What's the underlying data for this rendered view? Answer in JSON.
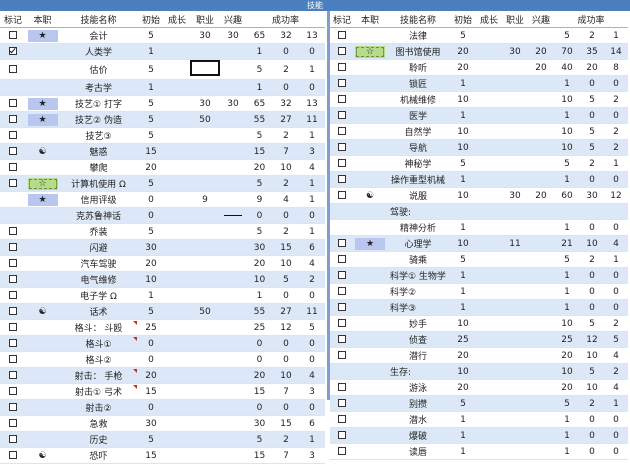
{
  "banner": {
    "title": "技能"
  },
  "headers": [
    "标记",
    "本职",
    "技能名称",
    "初始",
    "成长",
    "职业",
    "兴趣",
    "成功率"
  ],
  "left_rows": [
    {
      "mark": "empty",
      "occ": "star",
      "occ_style": "blue",
      "name": "会计",
      "base": "5",
      "grow": "",
      "job": "30",
      "hobby": "30",
      "s1": "65",
      "s2": "32",
      "s3": "13"
    },
    {
      "mark": "checked",
      "occ": "",
      "occ_style": "",
      "name": "人类学",
      "base": "1",
      "grow": "",
      "job": "",
      "hobby": "",
      "s1": "1",
      "s2": "0",
      "s3": "0"
    },
    {
      "mark": "empty",
      "occ": "",
      "occ_style": "",
      "name": "估价",
      "base": "5",
      "grow": "",
      "job": "",
      "hobby": "",
      "s1": "5",
      "s2": "2",
      "s3": "1",
      "job_boxed": true
    },
    {
      "mark": "none",
      "occ": "",
      "occ_style": "",
      "name": "考古学",
      "base": "1",
      "grow": "",
      "job": "",
      "hobby": "",
      "s1": "1",
      "s2": "0",
      "s3": "0"
    },
    {
      "mark": "empty",
      "occ": "star",
      "occ_style": "blue",
      "name": "技艺① 打字",
      "base": "5",
      "grow": "",
      "job": "30",
      "hobby": "30",
      "s1": "65",
      "s2": "32",
      "s3": "13"
    },
    {
      "mark": "empty",
      "occ": "star",
      "occ_style": "blue",
      "name": "技艺② 伪造",
      "base": "5",
      "grow": "",
      "job": "50",
      "hobby": "",
      "s1": "55",
      "s2": "27",
      "s3": "11"
    },
    {
      "mark": "empty",
      "occ": "",
      "occ_style": "",
      "name": "技艺③",
      "base": "5",
      "grow": "",
      "job": "",
      "hobby": "",
      "s1": "5",
      "s2": "2",
      "s3": "1"
    },
    {
      "mark": "empty",
      "occ": "yinyang",
      "occ_style": "",
      "name": "魅惑",
      "base": "15",
      "grow": "",
      "job": "",
      "hobby": "",
      "s1": "15",
      "s2": "7",
      "s3": "3"
    },
    {
      "mark": "empty",
      "occ": "",
      "occ_style": "",
      "name": "攀爬",
      "base": "20",
      "grow": "",
      "job": "",
      "hobby": "",
      "s1": "20",
      "s2": "10",
      "s3": "4"
    },
    {
      "mark": "empty",
      "occ": "hollow-star",
      "occ_style": "green",
      "name": "计算机使用 Ω",
      "base": "5",
      "grow": "",
      "job": "",
      "hobby": "",
      "s1": "5",
      "s2": "2",
      "s3": "1"
    },
    {
      "mark": "none",
      "occ": "star",
      "occ_style": "blue",
      "name": "信用评级",
      "base": "0",
      "grow": "",
      "job": "9",
      "hobby": "",
      "s1": "9",
      "s2": "4",
      "s3": "1"
    },
    {
      "mark": "none",
      "occ": "",
      "occ_style": "",
      "name": "克苏鲁神话",
      "base": "0",
      "grow": "",
      "job": "",
      "hobby": "",
      "s1": "0",
      "s2": "0",
      "s3": "0",
      "hobby_dash": true
    },
    {
      "mark": "empty",
      "occ": "",
      "occ_style": "",
      "name": "乔装",
      "base": "5",
      "grow": "",
      "job": "",
      "hobby": "",
      "s1": "5",
      "s2": "2",
      "s3": "1"
    },
    {
      "mark": "empty",
      "occ": "",
      "occ_style": "",
      "name": "闪避",
      "base": "30",
      "grow": "",
      "job": "",
      "hobby": "",
      "s1": "30",
      "s2": "15",
      "s3": "6"
    },
    {
      "mark": "empty",
      "occ": "",
      "occ_style": "",
      "name": "汽车驾驶",
      "base": "20",
      "grow": "",
      "job": "",
      "hobby": "",
      "s1": "20",
      "s2": "10",
      "s3": "4"
    },
    {
      "mark": "empty",
      "occ": "",
      "occ_style": "",
      "name": "电气维修",
      "base": "10",
      "grow": "",
      "job": "",
      "hobby": "",
      "s1": "10",
      "s2": "5",
      "s3": "2"
    },
    {
      "mark": "empty",
      "occ": "",
      "occ_style": "",
      "name": "电子学 Ω",
      "base": "1",
      "grow": "",
      "job": "",
      "hobby": "",
      "s1": "1",
      "s2": "0",
      "s3": "0"
    },
    {
      "mark": "empty",
      "occ": "yinyang",
      "occ_style": "",
      "name": "话术",
      "base": "5",
      "grow": "",
      "job": "50",
      "hobby": "",
      "s1": "55",
      "s2": "27",
      "s3": "11"
    },
    {
      "mark": "empty",
      "occ": "",
      "occ_style": "",
      "name": "格斗：  斗殴",
      "base": "25",
      "grow": "",
      "job": "",
      "hobby": "",
      "s1": "25",
      "s2": "12",
      "s3": "5",
      "flag": true
    },
    {
      "mark": "empty",
      "occ": "",
      "occ_style": "",
      "name": "格斗①",
      "base": "0",
      "grow": "",
      "job": "",
      "hobby": "",
      "s1": "0",
      "s2": "0",
      "s3": "0",
      "flag": true
    },
    {
      "mark": "empty",
      "occ": "",
      "occ_style": "",
      "name": "格斗②",
      "base": "0",
      "grow": "",
      "job": "",
      "hobby": "",
      "s1": "0",
      "s2": "0",
      "s3": "0"
    },
    {
      "mark": "empty",
      "occ": "",
      "occ_style": "",
      "name": "射击：  手枪",
      "base": "20",
      "grow": "",
      "job": "",
      "hobby": "",
      "s1": "20",
      "s2": "10",
      "s3": "4",
      "flag": true
    },
    {
      "mark": "empty",
      "occ": "",
      "occ_style": "",
      "name": "射击① 弓术",
      "base": "15",
      "grow": "",
      "job": "",
      "hobby": "",
      "s1": "15",
      "s2": "7",
      "s3": "3",
      "flag": true
    },
    {
      "mark": "empty",
      "occ": "",
      "occ_style": "",
      "name": "射击②",
      "base": "0",
      "grow": "",
      "job": "",
      "hobby": "",
      "s1": "0",
      "s2": "0",
      "s3": "0"
    },
    {
      "mark": "empty",
      "occ": "",
      "occ_style": "",
      "name": "急救",
      "base": "30",
      "grow": "",
      "job": "",
      "hobby": "",
      "s1": "30",
      "s2": "15",
      "s3": "6"
    },
    {
      "mark": "empty",
      "occ": "",
      "occ_style": "",
      "name": "历史",
      "base": "5",
      "grow": "",
      "job": "",
      "hobby": "",
      "s1": "5",
      "s2": "2",
      "s3": "1"
    },
    {
      "mark": "empty",
      "occ": "yinyang",
      "occ_style": "",
      "name": "恐吓",
      "base": "15",
      "grow": "",
      "job": "",
      "hobby": "",
      "s1": "15",
      "s2": "7",
      "s3": "3"
    }
  ],
  "right_rows": [
    {
      "mark": "empty",
      "occ": "",
      "occ_style": "",
      "name": "法律",
      "base": "5",
      "grow": "",
      "job": "",
      "hobby": "",
      "s1": "5",
      "s2": "2",
      "s3": "1"
    },
    {
      "mark": "empty",
      "occ": "hollow-star",
      "occ_style": "green",
      "name": "图书馆使用",
      "base": "20",
      "grow": "",
      "job": "30",
      "hobby": "20",
      "s1": "70",
      "s2": "35",
      "s3": "14"
    },
    {
      "mark": "empty",
      "occ": "",
      "occ_style": "",
      "name": "聆听",
      "base": "20",
      "grow": "",
      "job": "",
      "hobby": "20",
      "s1": "40",
      "s2": "20",
      "s3": "8"
    },
    {
      "mark": "empty",
      "occ": "",
      "occ_style": "",
      "name": "锁匠",
      "base": "1",
      "grow": "",
      "job": "",
      "hobby": "",
      "s1": "1",
      "s2": "0",
      "s3": "0"
    },
    {
      "mark": "empty",
      "occ": "",
      "occ_style": "",
      "name": "机械维修",
      "base": "10",
      "grow": "",
      "job": "",
      "hobby": "",
      "s1": "10",
      "s2": "5",
      "s3": "2"
    },
    {
      "mark": "empty",
      "occ": "",
      "occ_style": "",
      "name": "医学",
      "base": "1",
      "grow": "",
      "job": "",
      "hobby": "",
      "s1": "1",
      "s2": "0",
      "s3": "0"
    },
    {
      "mark": "empty",
      "occ": "",
      "occ_style": "",
      "name": "自然学",
      "base": "10",
      "grow": "",
      "job": "",
      "hobby": "",
      "s1": "10",
      "s2": "5",
      "s3": "2"
    },
    {
      "mark": "empty",
      "occ": "",
      "occ_style": "",
      "name": "导航",
      "base": "10",
      "grow": "",
      "job": "",
      "hobby": "",
      "s1": "10",
      "s2": "5",
      "s3": "2"
    },
    {
      "mark": "empty",
      "occ": "",
      "occ_style": "",
      "name": "神秘学",
      "base": "5",
      "grow": "",
      "job": "",
      "hobby": "",
      "s1": "5",
      "s2": "2",
      "s3": "1"
    },
    {
      "mark": "empty",
      "occ": "",
      "occ_style": "",
      "name": "操作重型机械",
      "base": "1",
      "grow": "",
      "job": "",
      "hobby": "",
      "s1": "1",
      "s2": "0",
      "s3": "0"
    },
    {
      "mark": "empty",
      "occ": "yinyang",
      "occ_style": "",
      "name": "说服",
      "base": "10",
      "grow": "",
      "job": "30",
      "hobby": "20",
      "s1": "60",
      "s2": "30",
      "s3": "12"
    },
    {
      "mark": "none",
      "occ": "",
      "occ_style": "",
      "name": "驾驶:",
      "base": "",
      "grow": "",
      "job": "",
      "hobby": "",
      "s1": "",
      "s2": "",
      "s3": "",
      "left_name": true
    },
    {
      "mark": "none",
      "occ": "",
      "occ_style": "",
      "name": "精神分析",
      "base": "1",
      "grow": "",
      "job": "",
      "hobby": "",
      "s1": "1",
      "s2": "0",
      "s3": "0"
    },
    {
      "mark": "empty",
      "occ": "star",
      "occ_style": "blue",
      "name": "心理学",
      "base": "10",
      "grow": "",
      "job": "11",
      "hobby": "",
      "s1": "21",
      "s2": "10",
      "s3": "4"
    },
    {
      "mark": "empty",
      "occ": "",
      "occ_style": "",
      "name": "骑乘",
      "base": "5",
      "grow": "",
      "job": "",
      "hobby": "",
      "s1": "5",
      "s2": "2",
      "s3": "1"
    },
    {
      "mark": "empty",
      "occ": "",
      "occ_style": "",
      "name": "科学① 生物学",
      "base": "1",
      "grow": "",
      "job": "",
      "hobby": "",
      "s1": "1",
      "s2": "0",
      "s3": "0",
      "left_name": true
    },
    {
      "mark": "empty",
      "occ": "",
      "occ_style": "",
      "name": "科学②",
      "base": "1",
      "grow": "",
      "job": "",
      "hobby": "",
      "s1": "1",
      "s2": "0",
      "s3": "0",
      "left_name": true
    },
    {
      "mark": "empty",
      "occ": "",
      "occ_style": "",
      "name": "科学③",
      "base": "1",
      "grow": "",
      "job": "",
      "hobby": "",
      "s1": "1",
      "s2": "0",
      "s3": "0",
      "left_name": true
    },
    {
      "mark": "empty",
      "occ": "",
      "occ_style": "",
      "name": "妙手",
      "base": "10",
      "grow": "",
      "job": "",
      "hobby": "",
      "s1": "10",
      "s2": "5",
      "s3": "2"
    },
    {
      "mark": "empty",
      "occ": "",
      "occ_style": "",
      "name": "侦查",
      "base": "25",
      "grow": "",
      "job": "",
      "hobby": "",
      "s1": "25",
      "s2": "12",
      "s3": "5"
    },
    {
      "mark": "empty",
      "occ": "",
      "occ_style": "",
      "name": "潜行",
      "base": "20",
      "grow": "",
      "job": "",
      "hobby": "",
      "s1": "20",
      "s2": "10",
      "s3": "4"
    },
    {
      "mark": "none",
      "occ": "",
      "occ_style": "",
      "name": "生存:",
      "base": "10",
      "grow": "",
      "job": "",
      "hobby": "",
      "s1": "10",
      "s2": "5",
      "s3": "2",
      "left_name": true
    },
    {
      "mark": "empty",
      "occ": "",
      "occ_style": "",
      "name": "游泳",
      "base": "20",
      "grow": "",
      "job": "",
      "hobby": "",
      "s1": "20",
      "s2": "10",
      "s3": "4"
    },
    {
      "mark": "empty",
      "occ": "",
      "occ_style": "",
      "name": "别攒",
      "base": "5",
      "grow": "",
      "job": "",
      "hobby": "",
      "s1": "5",
      "s2": "2",
      "s3": "1"
    },
    {
      "mark": "empty",
      "occ": "",
      "occ_style": "",
      "name": "潜水",
      "base": "1",
      "grow": "",
      "job": "",
      "hobby": "",
      "s1": "1",
      "s2": "0",
      "s3": "0"
    },
    {
      "mark": "empty",
      "occ": "",
      "occ_style": "",
      "name": "爆破",
      "base": "1",
      "grow": "",
      "job": "",
      "hobby": "",
      "s1": "1",
      "s2": "0",
      "s3": "0"
    },
    {
      "mark": "empty",
      "occ": "",
      "occ_style": "",
      "name": "读唇",
      "base": "1",
      "grow": "",
      "job": "",
      "hobby": "",
      "s1": "1",
      "s2": "0",
      "s3": "0"
    }
  ],
  "icons": {
    "star": "★",
    "hollow-star": "☆",
    "yinyang": "☯"
  },
  "colors": {
    "banner": "#4c7fbf",
    "band": "#dce8f7",
    "occ_blue": "#b9c7ee",
    "occ_green": "#b6dc8a"
  }
}
